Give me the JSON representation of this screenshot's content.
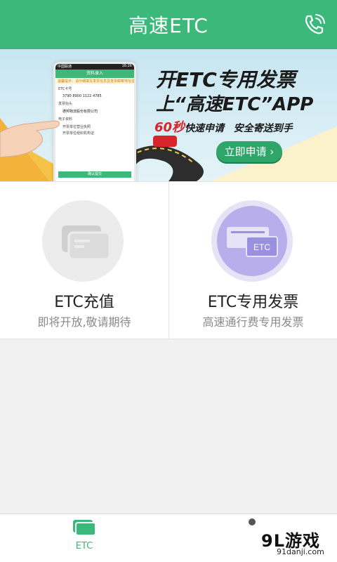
{
  "header": {
    "title": "高速ETC"
  },
  "banner": {
    "headline1": "开ETC专用发票",
    "headline2": "上“高速ETC”APP",
    "tag_num": "60秒",
    "tag_text": "快速申请",
    "tag_text2": "安全寄送到手",
    "cta": "立即申请",
    "phone": {
      "status_left": "中国联通",
      "status_right": "16:26",
      "screen_title": "资料录入",
      "notice": "温馨提示：请仔细填写发票信息及发票邮寄地址信息",
      "etc_label": "ETC卡号",
      "card_no": "3790 8900 1122 4785",
      "invoice_label": "发票抬头",
      "company": "德邦物流股份有限公司",
      "electronic_label": "电子资料",
      "item1": "开票单位营业执照",
      "item2": "开票单位组织机构证",
      "confirm": "确认提交"
    }
  },
  "cards": [
    {
      "title": "ETC充值",
      "subtitle": "即将开放,敬请期待"
    },
    {
      "title": "ETC专用发票",
      "subtitle": "高速通行费专用发票",
      "icon_text": "ETC"
    }
  ],
  "bottom_nav": {
    "tab_etc": "ETC"
  },
  "watermark": {
    "logo": "9L游戏",
    "url": "91danji.com"
  },
  "colors": {
    "primary": "#3bb87a",
    "banner_red": "#d8242b",
    "card_purple": "#9b8fe0"
  }
}
